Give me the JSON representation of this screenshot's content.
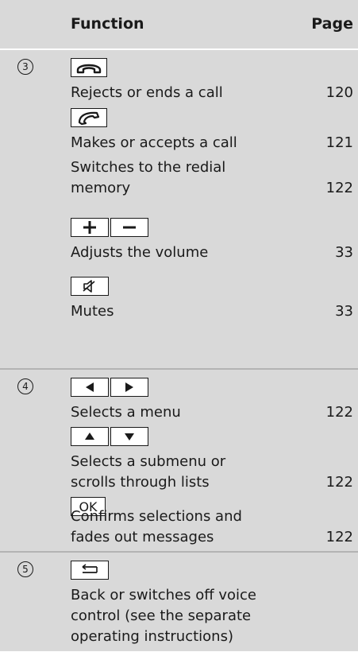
{
  "header": {
    "function_label": "Function",
    "page_label": "Page"
  },
  "groups": [
    {
      "number": "3",
      "rows": [
        {
          "text": "Rejects or ends a call",
          "page": "120"
        },
        {
          "text": "Makes or accepts a call",
          "page": "121"
        },
        {
          "text_line1": "Switches to the redial",
          "text_line2": "memory",
          "page": "122"
        },
        {
          "text": "Adjusts the volume",
          "page": "33"
        },
        {
          "text": "Mutes",
          "page": "33"
        }
      ]
    },
    {
      "number": "4",
      "rows": [
        {
          "text": "Selects a menu",
          "page": "122"
        },
        {
          "text_line1": "Selects a submenu or",
          "text_line2": "scrolls through lists",
          "page": "122"
        },
        {
          "key_label": "OK",
          "text_line1": "Confirms selections and",
          "text_line2": "fades out messages",
          "page": "122"
        }
      ]
    },
    {
      "number": "5",
      "rows": [
        {
          "text_line1": "Back or switches off voice",
          "text_line2": "control (see the separate",
          "text_line3": "operating instructions)"
        }
      ]
    }
  ]
}
